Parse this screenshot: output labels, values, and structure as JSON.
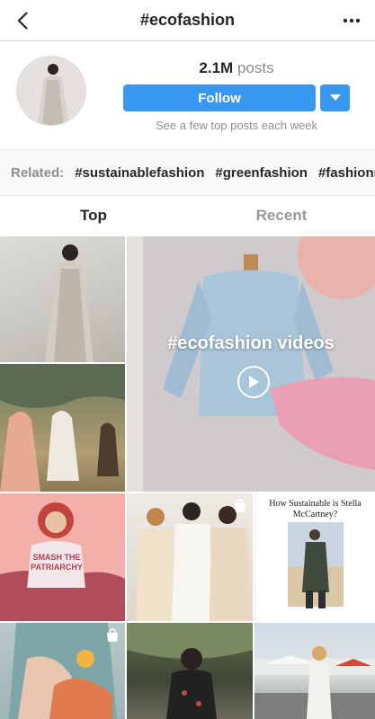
{
  "header": {
    "title": "#ecofashion"
  },
  "profile": {
    "posts_count": "2.1M",
    "posts_label": "posts",
    "follow_label": "Follow",
    "subtitle": "See a few top posts each week"
  },
  "related": {
    "label": "Related:",
    "tags": [
      "#sustainablefashion",
      "#greenfashion",
      "#fashionre"
    ]
  },
  "tabs": [
    "Top",
    "Recent"
  ],
  "grid": {
    "video_overlay": "#ecofashion videos",
    "poster_text": "SMASH THE PATRIARCHY",
    "caption": "How Sustainable is Stella McCartney?"
  },
  "icons": [
    "back-arrow-icon",
    "more-options-icon",
    "chevron-down-icon",
    "play-icon",
    "shopping-bag-icon"
  ],
  "colors": {
    "accent": "#3897f0",
    "muted": "#8e8e8e",
    "text": "#262626"
  }
}
